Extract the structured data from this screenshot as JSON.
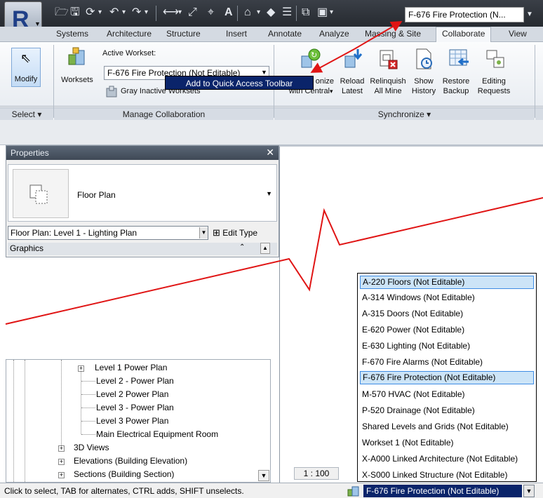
{
  "qat": {
    "workset_value": "F-676 Fire Protection (N...",
    "icons": [
      "open-icon",
      "save-icon",
      "sync-icon",
      "undo-icon",
      "redo-icon",
      "measure-icon",
      "dimension-icon",
      "tag-icon",
      "text-icon",
      "view-3d-icon",
      "section-icon",
      "thin-lines-icon",
      "close-windows-icon",
      "switch-windows-icon"
    ]
  },
  "tabs": [
    "Systems",
    "Architecture",
    "Structure",
    "Insert",
    "Annotate",
    "Analyze",
    "Massing & Site",
    "Collaborate",
    "View"
  ],
  "active_tab": "Collaborate",
  "ribbon": {
    "modify_label": "Modify",
    "worksets_label": "Worksets",
    "active_workset_label": "Active Workset:",
    "active_workset_value": "F-676 Fire Protection (Not Editable)",
    "gray_inactive_label": "Gray Inactive Worksets",
    "sync_label_line1": "onize",
    "sync_label_line2": "with Central",
    "reload_line1": "Reload",
    "reload_line2": "Latest",
    "relinquish_line1": "Relinquish",
    "relinquish_line2": "All Mine",
    "show_history_line1": "Show",
    "show_history_line2": "History",
    "restore_line1": "Restore",
    "restore_line2": "Backup",
    "editing_line1": "Editing",
    "editing_line2": "Requests",
    "select_panel": "Select ▾",
    "manage_panel": "Manage Collaboration",
    "sync_panel": "Synchronize ▾"
  },
  "context_menu": {
    "item": "Add to Quick Access Toolbar"
  },
  "properties": {
    "title": "Properties",
    "type_name": "Floor Plan",
    "instance": "Floor Plan: Level 1 - Lighting Plan",
    "edit_type": "Edit Type",
    "graphics": "Graphics"
  },
  "browser": {
    "items": [
      "Level 1 Power Plan",
      "Level 2 - Power Plan",
      "Level 2 Power Plan",
      "Level 3 - Power Plan",
      "Level 3 Power Plan",
      "Main Electrical Equipment Room",
      "3D Views",
      "Elevations (Building Elevation)",
      "Sections (Building Section)"
    ]
  },
  "workset_list": {
    "items": [
      "A-220 Floors (Not Editable)",
      "A-314 Windows (Not Editable)",
      "A-315 Doors (Not Editable)",
      "E-620 Power (Not Editable)",
      "E-630 Lighting (Not Editable)",
      "F-670 Fire Alarms (Not Editable)",
      "F-676 Fire Protection (Not Editable)",
      "M-570 HVAC (Not Editable)",
      "P-520 Drainage (Not Editable)",
      "Shared Levels and Grids (Not Editable)",
      "Workset 1 (Not Editable)",
      "X-A000 Linked Architecture (Not Editable)",
      "X-S000 Linked Structure (Not Editable)"
    ]
  },
  "scale": "1 : 100",
  "status": {
    "text": "Click to select, TAB for alternates, CTRL adds, SHIFT unselects.",
    "workset": "F-676 Fire Protection (Not Editable)"
  },
  "colors": {
    "annotation_red": "#e01414",
    "menu_highlight": "#0a246a",
    "list_highlight": "#cce4f7"
  }
}
